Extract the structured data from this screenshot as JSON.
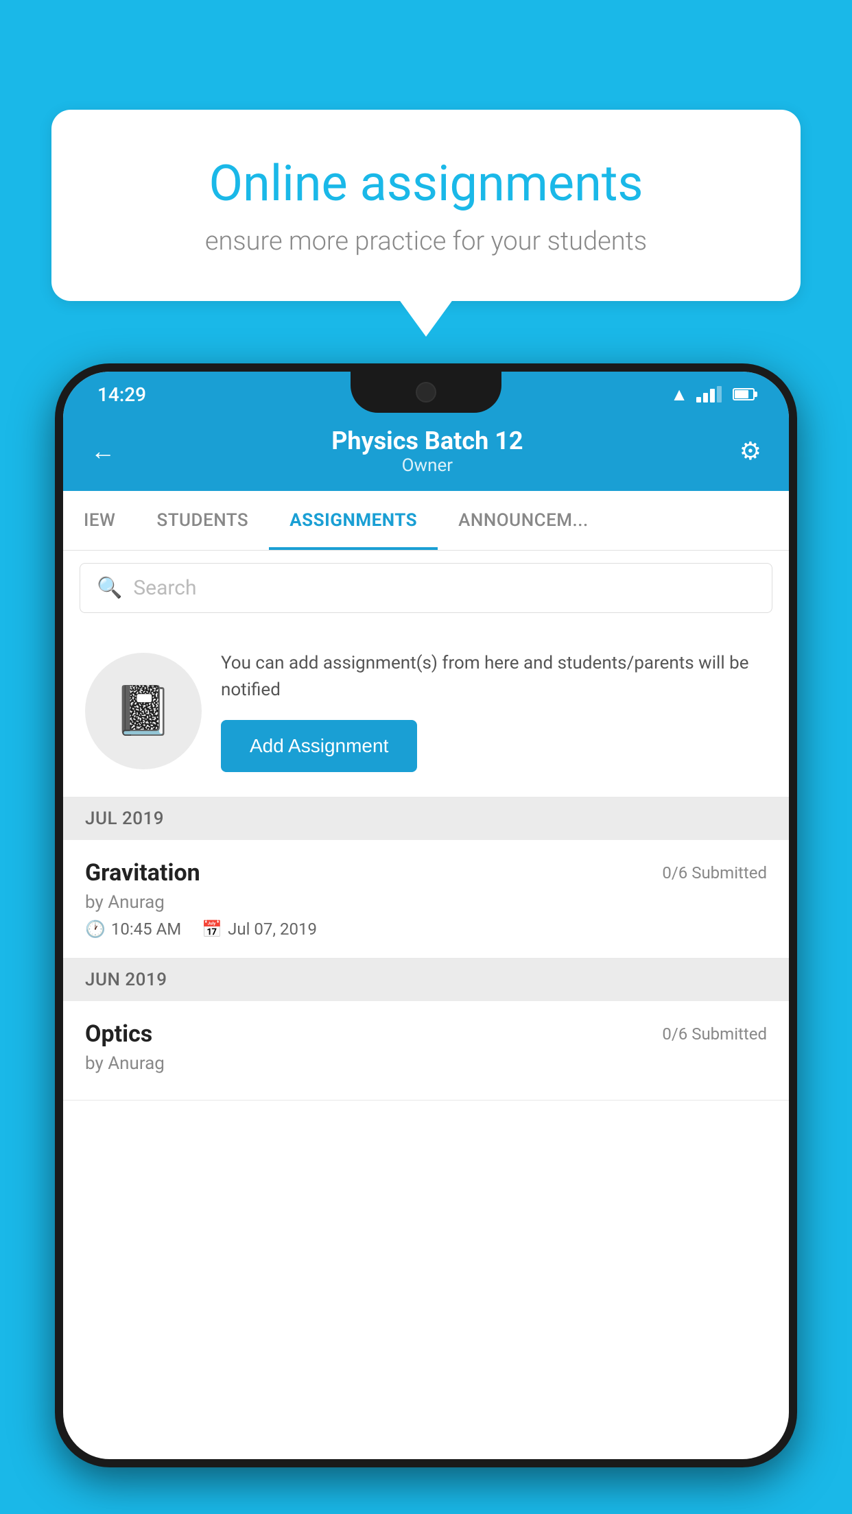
{
  "background_color": "#1ab8e8",
  "speech_bubble": {
    "title": "Online assignments",
    "subtitle": "ensure more practice for your students"
  },
  "status_bar": {
    "time": "14:29",
    "wifi": "▼",
    "battery_percent": 70
  },
  "header": {
    "title": "Physics Batch 12",
    "subtitle": "Owner",
    "back_label": "←",
    "settings_label": "⚙"
  },
  "tabs": [
    {
      "label": "IEW",
      "active": false
    },
    {
      "label": "STUDENTS",
      "active": false
    },
    {
      "label": "ASSIGNMENTS",
      "active": true
    },
    {
      "label": "ANNOUNCEM...",
      "active": false
    }
  ],
  "search": {
    "placeholder": "Search"
  },
  "promo": {
    "description": "You can add assignment(s) from here and students/parents will be notified",
    "button_label": "Add Assignment"
  },
  "sections": [
    {
      "header": "JUL 2019",
      "assignments": [
        {
          "title": "Gravitation",
          "submitted": "0/6 Submitted",
          "author": "by Anurag",
          "time": "10:45 AM",
          "date": "Jul 07, 2019"
        }
      ]
    },
    {
      "header": "JUN 2019",
      "assignments": [
        {
          "title": "Optics",
          "submitted": "0/6 Submitted",
          "author": "by Anurag",
          "time": "",
          "date": ""
        }
      ]
    }
  ]
}
